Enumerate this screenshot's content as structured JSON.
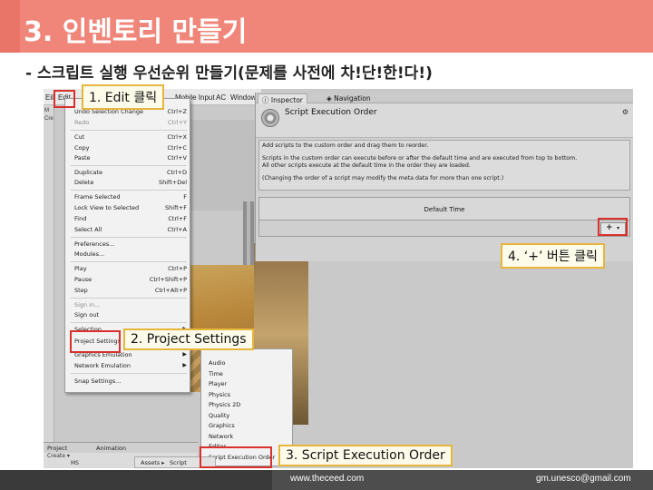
{
  "slide": {
    "title": "3. 인벤토리 만들기",
    "subtitle": "- 스크립트 실행 우선순위 만들기(문제를 사전에 차!단!한!다!)"
  },
  "editor": {
    "menubar": [
      "Eil",
      "Edit",
      "Mobile Input",
      "AC",
      "Window"
    ],
    "left_labels": [
      "Sh",
      "Cre",
      "M"
    ]
  },
  "edit_menu": {
    "items": [
      {
        "label": "Undo Selection Change",
        "shortcut": "Ctrl+Z"
      },
      {
        "label": "Redo",
        "shortcut": "Ctrl+Y",
        "disabled": true
      },
      {
        "label": "Cut",
        "shortcut": "Ctrl+X"
      },
      {
        "label": "Copy",
        "shortcut": "Ctrl+C"
      },
      {
        "label": "Paste",
        "shortcut": "Ctrl+V"
      },
      {
        "label": "Duplicate",
        "shortcut": "Ctrl+D"
      },
      {
        "label": "Delete",
        "shortcut": "Shift+Del"
      },
      {
        "label": "Frame Selected",
        "shortcut": "F"
      },
      {
        "label": "Lock View to Selected",
        "shortcut": "Shift+F"
      },
      {
        "label": "Find",
        "shortcut": "Ctrl+F"
      },
      {
        "label": "Select All",
        "shortcut": "Ctrl+A"
      },
      {
        "label": "Preferences...",
        "shortcut": ""
      },
      {
        "label": "Modules...",
        "shortcut": ""
      },
      {
        "label": "Play",
        "shortcut": "Ctrl+P"
      },
      {
        "label": "Pause",
        "shortcut": "Ctrl+Shift+P"
      },
      {
        "label": "Step",
        "shortcut": "Ctrl+Alt+P"
      },
      {
        "label": "Sign in...",
        "shortcut": "",
        "disabled": true
      },
      {
        "label": "Sign out",
        "shortcut": ""
      },
      {
        "label": "Selection",
        "shortcut": ""
      },
      {
        "label": "Project Settings",
        "shortcut": ""
      },
      {
        "label": "Graphics Emulation",
        "shortcut": ""
      },
      {
        "label": "Network Emulation",
        "shortcut": ""
      },
      {
        "label": "Snap Settings...",
        "shortcut": ""
      }
    ]
  },
  "project_settings_menu": {
    "items": [
      "Audio",
      "Time",
      "Player",
      "Physics",
      "Physics 2D",
      "Quality",
      "Graphics",
      "Network",
      "Editor",
      "Script Execution Order"
    ]
  },
  "inspector": {
    "tabs": [
      "Inspector",
      "Navigation"
    ],
    "title": "Script Execution Order",
    "desc_line1": "Add scripts to the custom order and drag them to reorder.",
    "desc_line2": "Scripts in the custom order can execute before or after the default time and are executed from top to bottom.",
    "desc_line3": "All other scripts execute at the default time in the order they are loaded.",
    "desc_line4": "(Changing the order of a script may modify the meta data for more than one script.)",
    "default_time": "Default Time",
    "plus": "+",
    "dropdown_arrow": "▾"
  },
  "bottom_panel": {
    "tabs": [
      "Project",
      "Animation"
    ],
    "create": "Create ▾",
    "breadcrumb_root": "Assets ▸",
    "breadcrumb_leaf": "Script",
    "folder": "MS"
  },
  "callouts": {
    "step1": "1. Edit 클릭",
    "step2": "2. Project Settings",
    "step3": "3. Script Execution Order",
    "step4": "4. ‘+’ 버튼 클릭"
  },
  "footer": {
    "url": "www.theceed.com",
    "email": "gm.unesco@gmail.com"
  },
  "colors": {
    "banner": "#f0867a",
    "highlight": "#d8302c",
    "callout_border": "#e8b53c",
    "footer": "#4d4d4d"
  }
}
